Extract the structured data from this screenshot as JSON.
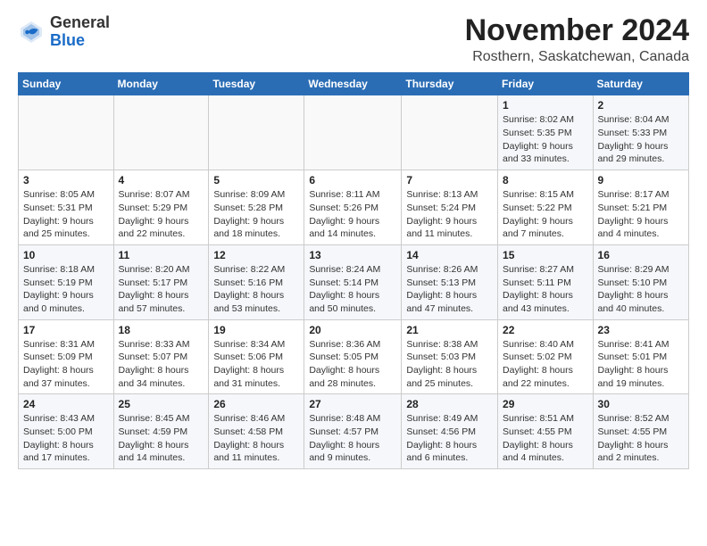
{
  "logo": {
    "general": "General",
    "blue": "Blue"
  },
  "header": {
    "month": "November 2024",
    "location": "Rosthern, Saskatchewan, Canada"
  },
  "weekdays": [
    "Sunday",
    "Monday",
    "Tuesday",
    "Wednesday",
    "Thursday",
    "Friday",
    "Saturday"
  ],
  "weeks": [
    [
      {
        "day": "",
        "info": ""
      },
      {
        "day": "",
        "info": ""
      },
      {
        "day": "",
        "info": ""
      },
      {
        "day": "",
        "info": ""
      },
      {
        "day": "",
        "info": ""
      },
      {
        "day": "1",
        "info": "Sunrise: 8:02 AM\nSunset: 5:35 PM\nDaylight: 9 hours and 33 minutes."
      },
      {
        "day": "2",
        "info": "Sunrise: 8:04 AM\nSunset: 5:33 PM\nDaylight: 9 hours and 29 minutes."
      }
    ],
    [
      {
        "day": "3",
        "info": "Sunrise: 8:05 AM\nSunset: 5:31 PM\nDaylight: 9 hours and 25 minutes."
      },
      {
        "day": "4",
        "info": "Sunrise: 8:07 AM\nSunset: 5:29 PM\nDaylight: 9 hours and 22 minutes."
      },
      {
        "day": "5",
        "info": "Sunrise: 8:09 AM\nSunset: 5:28 PM\nDaylight: 9 hours and 18 minutes."
      },
      {
        "day": "6",
        "info": "Sunrise: 8:11 AM\nSunset: 5:26 PM\nDaylight: 9 hours and 14 minutes."
      },
      {
        "day": "7",
        "info": "Sunrise: 8:13 AM\nSunset: 5:24 PM\nDaylight: 9 hours and 11 minutes."
      },
      {
        "day": "8",
        "info": "Sunrise: 8:15 AM\nSunset: 5:22 PM\nDaylight: 9 hours and 7 minutes."
      },
      {
        "day": "9",
        "info": "Sunrise: 8:17 AM\nSunset: 5:21 PM\nDaylight: 9 hours and 4 minutes."
      }
    ],
    [
      {
        "day": "10",
        "info": "Sunrise: 8:18 AM\nSunset: 5:19 PM\nDaylight: 9 hours and 0 minutes."
      },
      {
        "day": "11",
        "info": "Sunrise: 8:20 AM\nSunset: 5:17 PM\nDaylight: 8 hours and 57 minutes."
      },
      {
        "day": "12",
        "info": "Sunrise: 8:22 AM\nSunset: 5:16 PM\nDaylight: 8 hours and 53 minutes."
      },
      {
        "day": "13",
        "info": "Sunrise: 8:24 AM\nSunset: 5:14 PM\nDaylight: 8 hours and 50 minutes."
      },
      {
        "day": "14",
        "info": "Sunrise: 8:26 AM\nSunset: 5:13 PM\nDaylight: 8 hours and 47 minutes."
      },
      {
        "day": "15",
        "info": "Sunrise: 8:27 AM\nSunset: 5:11 PM\nDaylight: 8 hours and 43 minutes."
      },
      {
        "day": "16",
        "info": "Sunrise: 8:29 AM\nSunset: 5:10 PM\nDaylight: 8 hours and 40 minutes."
      }
    ],
    [
      {
        "day": "17",
        "info": "Sunrise: 8:31 AM\nSunset: 5:09 PM\nDaylight: 8 hours and 37 minutes."
      },
      {
        "day": "18",
        "info": "Sunrise: 8:33 AM\nSunset: 5:07 PM\nDaylight: 8 hours and 34 minutes."
      },
      {
        "day": "19",
        "info": "Sunrise: 8:34 AM\nSunset: 5:06 PM\nDaylight: 8 hours and 31 minutes."
      },
      {
        "day": "20",
        "info": "Sunrise: 8:36 AM\nSunset: 5:05 PM\nDaylight: 8 hours and 28 minutes."
      },
      {
        "day": "21",
        "info": "Sunrise: 8:38 AM\nSunset: 5:03 PM\nDaylight: 8 hours and 25 minutes."
      },
      {
        "day": "22",
        "info": "Sunrise: 8:40 AM\nSunset: 5:02 PM\nDaylight: 8 hours and 22 minutes."
      },
      {
        "day": "23",
        "info": "Sunrise: 8:41 AM\nSunset: 5:01 PM\nDaylight: 8 hours and 19 minutes."
      }
    ],
    [
      {
        "day": "24",
        "info": "Sunrise: 8:43 AM\nSunset: 5:00 PM\nDaylight: 8 hours and 17 minutes."
      },
      {
        "day": "25",
        "info": "Sunrise: 8:45 AM\nSunset: 4:59 PM\nDaylight: 8 hours and 14 minutes."
      },
      {
        "day": "26",
        "info": "Sunrise: 8:46 AM\nSunset: 4:58 PM\nDaylight: 8 hours and 11 minutes."
      },
      {
        "day": "27",
        "info": "Sunrise: 8:48 AM\nSunset: 4:57 PM\nDaylight: 8 hours and 9 minutes."
      },
      {
        "day": "28",
        "info": "Sunrise: 8:49 AM\nSunset: 4:56 PM\nDaylight: 8 hours and 6 minutes."
      },
      {
        "day": "29",
        "info": "Sunrise: 8:51 AM\nSunset: 4:55 PM\nDaylight: 8 hours and 4 minutes."
      },
      {
        "day": "30",
        "info": "Sunrise: 8:52 AM\nSunset: 4:55 PM\nDaylight: 8 hours and 2 minutes."
      }
    ]
  ]
}
